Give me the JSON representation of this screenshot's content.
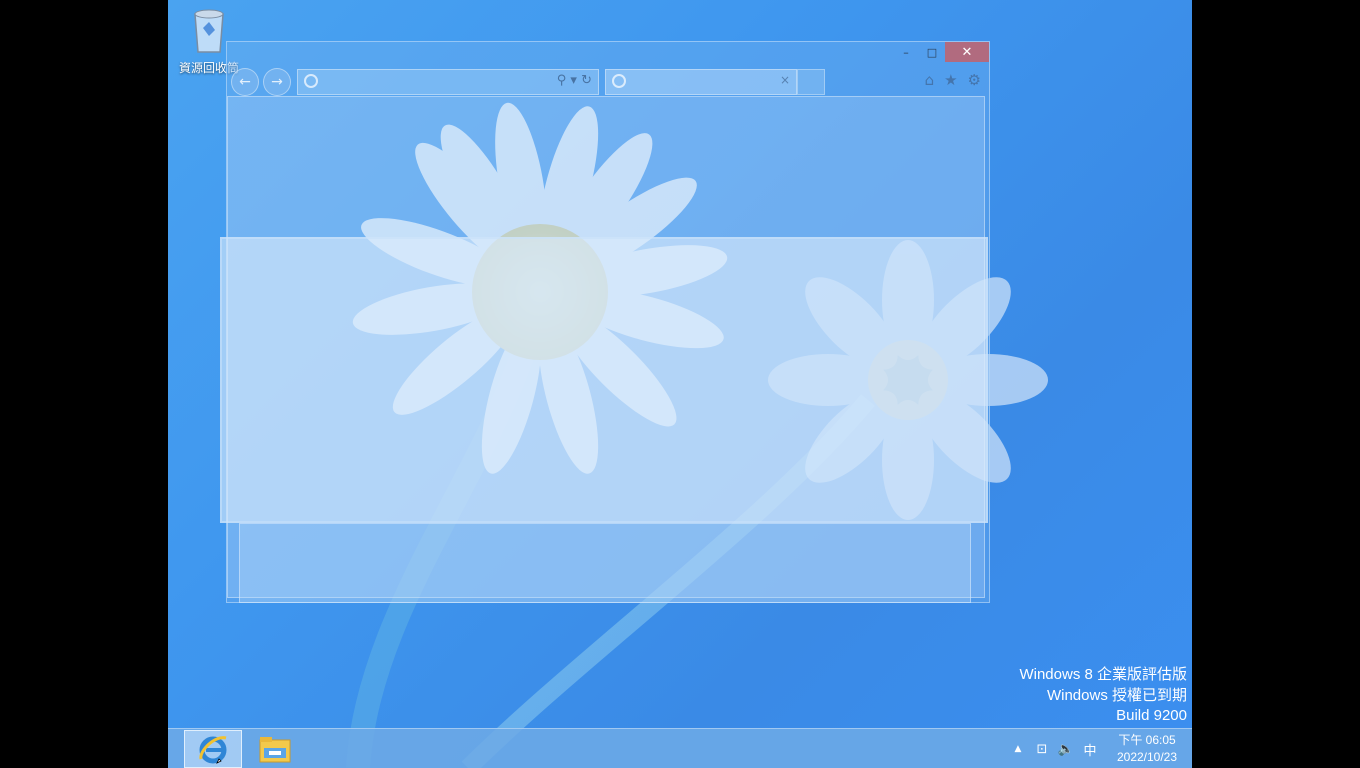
{
  "desktop": {
    "recycle_bin_label": "資源回收筒"
  },
  "ie_window": {
    "minimize": "–",
    "maximize": "□",
    "close": "✕",
    "back": "←",
    "forward": "→",
    "address_icons": "⚲ ▾ ↻",
    "tab_close": "×"
  },
  "watermark": {
    "line1": "Windows 8 企業版評估版",
    "line2": "Windows 授權已到期",
    "line3": "Build 9200"
  },
  "taskbar": {
    "apps": [
      "internet-explorer",
      "file-explorer"
    ],
    "tray": {
      "show_hidden": "▲",
      "network": "⊡",
      "volume": "🔈",
      "ime": "中"
    },
    "clock": {
      "time": "下午 06:05",
      "date": "2022/10/23"
    }
  },
  "colors": {
    "desktop_blue": "#3f97ef",
    "taskbar": "#6eaae6",
    "close_red": "#d25a5a"
  }
}
